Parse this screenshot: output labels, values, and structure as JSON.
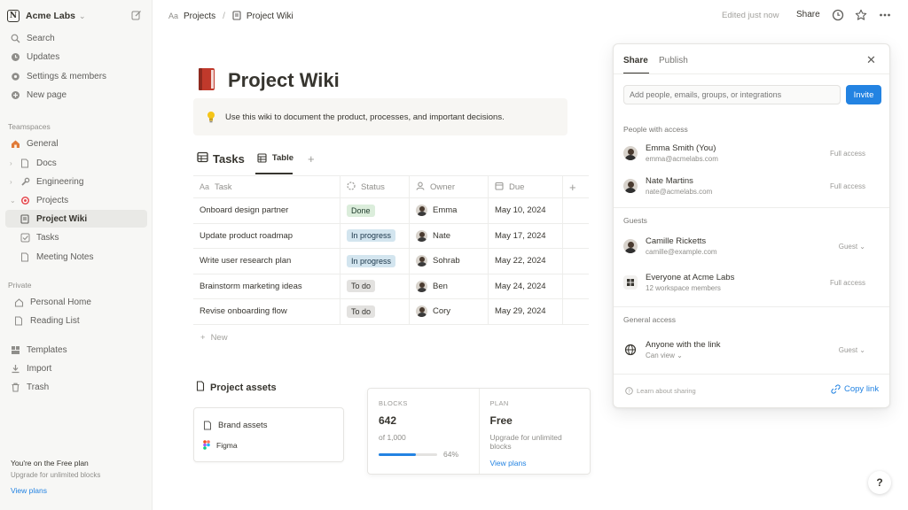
{
  "workspace": {
    "logo_letter": "N",
    "name": "Acme Labs"
  },
  "sidebar": {
    "nav": [
      {
        "label": "Search",
        "icon": "search-icon"
      },
      {
        "label": "Updates",
        "icon": "clock-icon"
      },
      {
        "label": "Settings & members",
        "icon": "gear-icon"
      },
      {
        "label": "New page",
        "icon": "plus-circle-icon"
      }
    ],
    "teamspaces_label": "Teamspaces",
    "teamspaces": [
      {
        "label": "General",
        "icon": "house-icon"
      },
      {
        "label": "Docs",
        "icon": "document-icon"
      },
      {
        "label": "Engineering",
        "icon": "wrench-icon"
      },
      {
        "label": "Projects",
        "icon": "target-icon"
      },
      {
        "label": "Project Wiki",
        "icon": "page-icon"
      },
      {
        "label": "Tasks",
        "icon": "checkbox-icon"
      },
      {
        "label": "Meeting Notes",
        "icon": "document-icon"
      }
    ],
    "private_label": "Private",
    "private": [
      {
        "label": "Personal Home",
        "icon": "house-icon"
      },
      {
        "label": "Reading List",
        "icon": "document-icon"
      }
    ],
    "bottom": [
      {
        "label": "Templates",
        "icon": "templates-icon"
      },
      {
        "label": "Import",
        "icon": "download-icon"
      },
      {
        "label": "Trash",
        "icon": "trash-icon"
      }
    ],
    "plan": {
      "title": "You're on the Free plan",
      "subtitle": "Upgrade for unlimited blocks",
      "link": "View plans"
    }
  },
  "topbar": {
    "breadcrumb": [
      {
        "label": "Projects"
      },
      {
        "label": "Project Wiki"
      }
    ],
    "breadcrumb_prefix": "Aa",
    "edited": "Edited just now",
    "share": "Share"
  },
  "page": {
    "title": "Project Wiki",
    "callout": "Use this wiki to document the product, processes, and important decisions."
  },
  "database": {
    "title": "Tasks",
    "view": "Table",
    "columns": [
      "Task",
      "Status",
      "Owner",
      "Due"
    ],
    "rows": [
      {
        "task": "Onboard design partner",
        "status": "Done",
        "owner": "Emma",
        "due": "May 10, 2024"
      },
      {
        "task": "Update product roadmap",
        "status": "In progress",
        "owner": "Nate",
        "due": "May 17, 2024"
      },
      {
        "task": "Write user research plan",
        "status": "In progress",
        "owner": "Sohrab",
        "due": "May 22, 2024"
      },
      {
        "task": "Brainstorm marketing ideas",
        "status": "To do",
        "owner": "Ben",
        "due": "May 24, 2024"
      },
      {
        "task": "Revise onboarding flow",
        "status": "To do",
        "owner": "Cory",
        "due": "May 29, 2024"
      }
    ],
    "new_row": "New",
    "status_colors": {
      "Done": [
        "#dbeddb",
        "#1c3829"
      ],
      "In progress": [
        "#d3e5ef",
        "#183347"
      ],
      "To do": [
        "#e3e2e0",
        "#32302c"
      ]
    }
  },
  "assets": {
    "title": "Project assets",
    "items": [
      {
        "label": "Brand assets"
      },
      {
        "label": "Figma"
      }
    ]
  },
  "stats": {
    "blocks": {
      "label": "BLOCKS",
      "value": "642",
      "sub": "of 1,000",
      "percent_text": "64%",
      "fraction": 0.64
    },
    "plan": {
      "label": "PLAN",
      "value": "Free",
      "sub": "Upgrade for unlimited blocks",
      "link": "View plans"
    }
  },
  "share_panel": {
    "tabs": [
      "Share",
      "Publish"
    ],
    "input_placeholder": "Add people, emails, groups, or integrations",
    "invite": "Invite",
    "people_label": "People with access",
    "people": [
      {
        "name": "Emma Smith (You)",
        "email": "emma@acmelabs.com",
        "access": "Full access"
      },
      {
        "name": "Nate Martins",
        "email": "nate@acmelabs.com",
        "access": "Full access"
      }
    ],
    "guests_label": "Guests",
    "guests": [
      {
        "name": "Camille Ricketts",
        "email": "camille@example.com",
        "access": "Guest"
      },
      {
        "name": "Everyone at Acme Labs",
        "email": "12 workspace members",
        "access": "Full access"
      }
    ],
    "general_label": "General access",
    "general": {
      "name": "Anyone with the link",
      "sub": "Can view",
      "access": "Guest"
    },
    "learn": "Learn about sharing",
    "copy_link": "Copy link"
  },
  "help": "?",
  "colors": {
    "accent": "#2383e2",
    "sidebar_bg": "#f7f7f5",
    "text": "#37352f"
  }
}
